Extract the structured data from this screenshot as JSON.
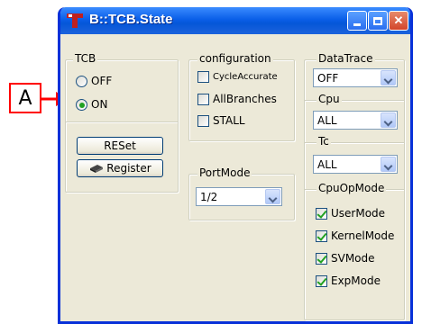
{
  "callout": {
    "label": "A"
  },
  "window": {
    "title": "B::TCB.State",
    "buttons": {
      "minimize": "_",
      "maximize": "□",
      "close": "✕"
    }
  },
  "tcb": {
    "label": "TCB",
    "options": [
      {
        "label": "OFF",
        "selected": false
      },
      {
        "label": "ON",
        "selected": true
      }
    ],
    "reset_button": "RESet",
    "register_button": "Register"
  },
  "configuration": {
    "label": "configuration",
    "options": [
      {
        "label": "CycleAccurate",
        "checked": false
      },
      {
        "label": "AllBranches",
        "checked": false
      },
      {
        "label": "STALL",
        "checked": false
      }
    ]
  },
  "portmode": {
    "label": "PortMode",
    "value": "1/2"
  },
  "datatrace": {
    "label": "DataTrace",
    "value": "OFF"
  },
  "cpu": {
    "label": "Cpu",
    "value": "ALL"
  },
  "tc": {
    "label": "Tc",
    "value": "ALL"
  },
  "cpuopmode": {
    "label": "CpuOpMode",
    "options": [
      {
        "label": "UserMode",
        "checked": true
      },
      {
        "label": "KernelMode",
        "checked": true
      },
      {
        "label": "SVMode",
        "checked": true
      },
      {
        "label": "ExpMode",
        "checked": true
      }
    ]
  },
  "colors": {
    "callout": "#ff0000",
    "titlebar": "#0a5fe8",
    "window_bg": "#ece9d8",
    "check": "#21a121"
  }
}
